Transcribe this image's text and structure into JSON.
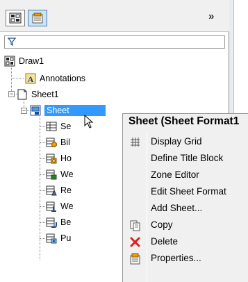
{
  "panel": {
    "tabs": [
      {
        "name": "feature-manager-tab",
        "icon": "feature-tree-icon"
      },
      {
        "name": "property-manager-tab",
        "icon": "property-manager-icon"
      }
    ],
    "more_tabs_glyph": "»",
    "filter": {
      "icon": "filter-icon",
      "value": ""
    }
  },
  "tree": {
    "root": {
      "label": "Draw1",
      "icon": "drawing-icon"
    },
    "annotations": {
      "label": "Annotations",
      "icon": "annotations-icon"
    },
    "sheet1": {
      "label": "Sheet1",
      "icon": "sheet-icon",
      "expanded": true
    },
    "sheet_format": {
      "label": "Sheet",
      "icon": "sheet-format-icon",
      "selected": true
    },
    "children": [
      {
        "label": "Se",
        "icon": "table-anchor-icon"
      },
      {
        "label": "Bil",
        "icon": "bom-anchor-icon"
      },
      {
        "label": "Ho",
        "icon": "hole-table-anchor-icon"
      },
      {
        "label": "We",
        "icon": "weldment-table-anchor-icon"
      },
      {
        "label": "Re",
        "icon": "revision-table-anchor-icon"
      },
      {
        "label": "We",
        "icon": "weld-table-anchor-icon"
      },
      {
        "label": "Be",
        "icon": "bend-table-anchor-icon"
      },
      {
        "label": "Pu",
        "icon": "punch-table-anchor-icon"
      }
    ]
  },
  "context_menu": {
    "title": "Sheet (Sheet Format1",
    "items": [
      {
        "label": "Display Grid",
        "icon": "grid-icon"
      },
      {
        "label": "Define Title Block",
        "icon": ""
      },
      {
        "label": "Zone Editor",
        "icon": ""
      },
      {
        "label": "Edit Sheet Format",
        "icon": ""
      },
      {
        "label": "Add Sheet...",
        "icon": ""
      },
      {
        "label": "Copy",
        "icon": "copy-icon"
      },
      {
        "label": "Delete",
        "icon": "delete-icon"
      },
      {
        "label": "Properties...",
        "icon": "properties-icon"
      }
    ]
  },
  "colors": {
    "selection": "#3399ff",
    "delete_red": "#e02020",
    "title_block_orange": "#e8a000"
  }
}
